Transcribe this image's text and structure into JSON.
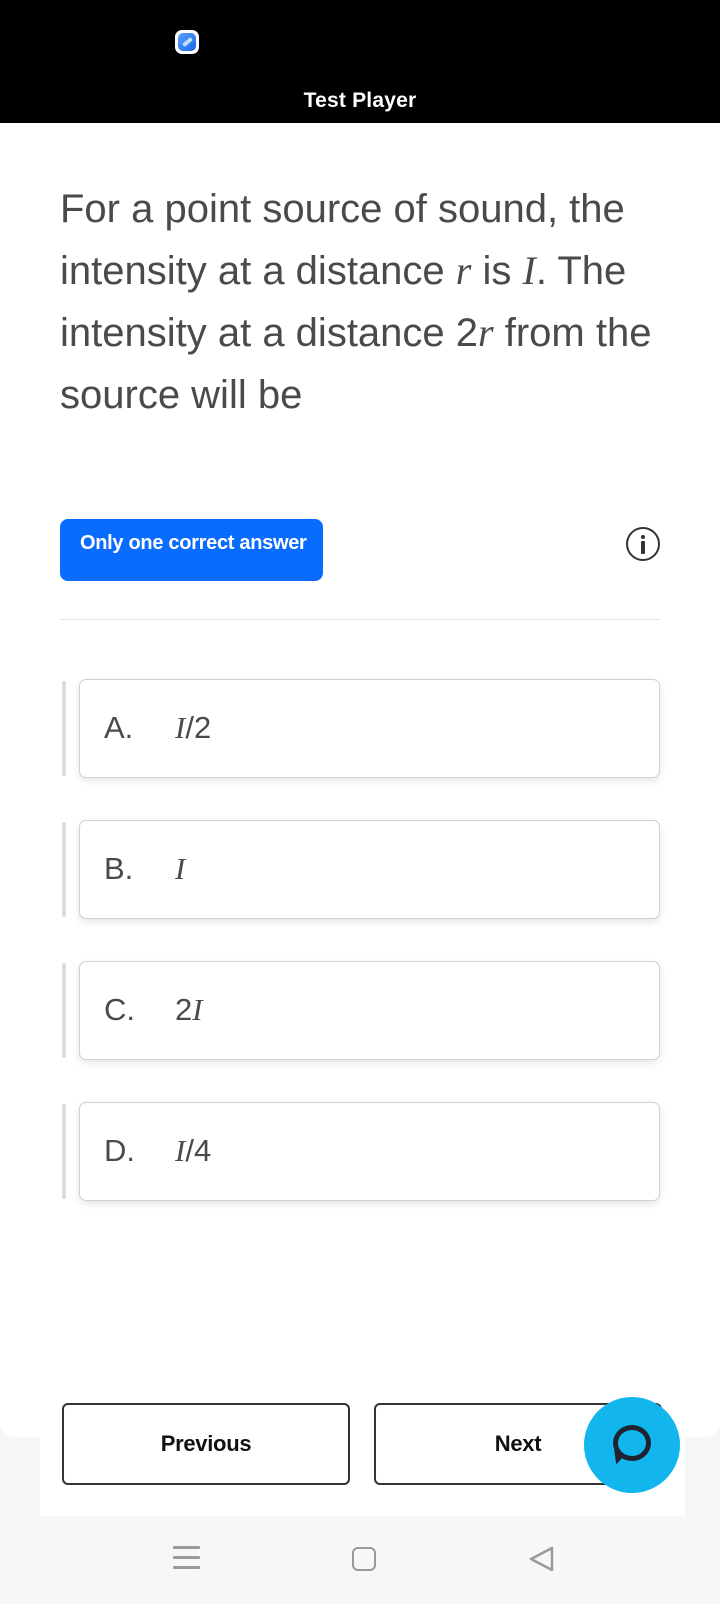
{
  "window": {
    "title": "Test Player"
  },
  "question": {
    "parts": [
      {
        "t": "For a point source of sound, the intensity at a distance "
      },
      {
        "t": "r",
        "i": true
      },
      {
        "t": " is "
      },
      {
        "t": "I",
        "i": true
      },
      {
        "t": ". The intensity at a distance 2"
      },
      {
        "t": "r",
        "i": true
      },
      {
        "t": " from the source will be"
      }
    ]
  },
  "answer_type": {
    "label": "Only one correct answer"
  },
  "options": [
    {
      "letter": "A.",
      "parts": [
        {
          "t": "I",
          "i": true
        },
        {
          "t": "/2"
        }
      ]
    },
    {
      "letter": "B.",
      "parts": [
        {
          "t": "I",
          "i": true
        }
      ]
    },
    {
      "letter": "C.",
      "parts": [
        {
          "t": "2"
        },
        {
          "t": "I",
          "i": true
        }
      ]
    },
    {
      "letter": "D.",
      "parts": [
        {
          "t": "I",
          "i": true
        },
        {
          "t": "/4"
        }
      ]
    }
  ],
  "navigation": {
    "previous_label": "Previous",
    "next_label": "Next"
  },
  "icons": {
    "app": "app-icon",
    "info": "info-icon",
    "chat": "chat-icon",
    "menu": "menu-icon",
    "home": "home-icon",
    "back": "back-icon"
  },
  "colors": {
    "accent": "#0a6cff",
    "fab": "#13b6ec",
    "status_bar": "#000000"
  }
}
